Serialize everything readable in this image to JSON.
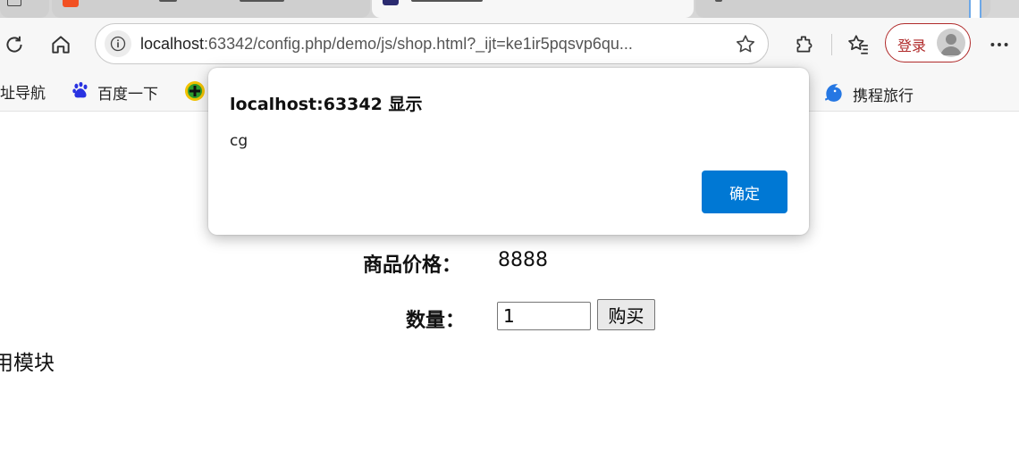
{
  "browser": {
    "url_host": "localhost",
    "url_rest": ":63342/config.php/demo/js/shop.html?_ijt=ke1ir5pqsvp6qu...",
    "login_label": "登录",
    "icons": [
      "refresh-icon",
      "home-icon",
      "info-icon",
      "favorite-star-icon",
      "extensions-icon",
      "favorites-icon",
      "avatar-icon",
      "more-icon"
    ]
  },
  "bookmarks": [
    {
      "label": "址导航",
      "icon": "none"
    },
    {
      "label": "百度一下",
      "icon": "baidu-paw-icon"
    },
    {
      "label": "",
      "icon": "green-plus-icon"
    },
    {
      "label": "携程旅行",
      "icon": "ctrip-dolphin-icon"
    }
  ],
  "page": {
    "price_label": "商品价格：",
    "price_value": "8888",
    "qty_label": "数量：",
    "qty_value": "1",
    "buy_label": "购买",
    "module_text": "用模块"
  },
  "dialog": {
    "title": "localhost:63342 显示",
    "message": "cg",
    "ok_label": "确定",
    "ok_color": "#0078d4"
  },
  "colors": {
    "login_accent": "#b02a2a",
    "toolbar_bg": "#f7f7f7"
  }
}
